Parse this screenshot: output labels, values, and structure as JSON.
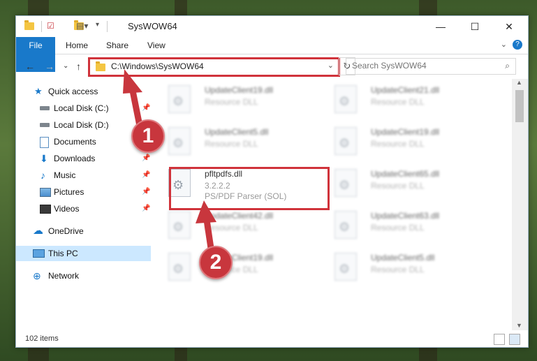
{
  "window": {
    "title": "SysWOW64",
    "controls": {
      "minimize": "—",
      "maximize": "☐",
      "close": "✕"
    }
  },
  "ribbon": {
    "tabs": [
      "File",
      "Home",
      "Share",
      "View"
    ],
    "help": "?"
  },
  "address": {
    "path": "C:\\Windows\\SysWOW64",
    "search_placeholder": "Search SysWOW64"
  },
  "sidebar": {
    "items": [
      {
        "label": "Quick access",
        "icon": "star-icon",
        "pinned": false
      },
      {
        "label": "Local Disk (C:)",
        "icon": "drive-icon",
        "pinned": true
      },
      {
        "label": "Local Disk (D:)",
        "icon": "drive-icon",
        "pinned": false
      },
      {
        "label": "Documents",
        "icon": "documents-icon",
        "pinned": true
      },
      {
        "label": "Downloads",
        "icon": "downloads-icon",
        "pinned": true
      },
      {
        "label": "Music",
        "icon": "music-icon",
        "pinned": true
      },
      {
        "label": "Pictures",
        "icon": "pictures-icon",
        "pinned": true
      },
      {
        "label": "Videos",
        "icon": "videos-icon",
        "pinned": true
      },
      {
        "label": "OneDrive",
        "icon": "onedrive-icon",
        "pinned": false
      },
      {
        "label": "This PC",
        "icon": "pc-icon",
        "pinned": false,
        "selected": true
      },
      {
        "label": "Network",
        "icon": "network-icon",
        "pinned": false
      }
    ]
  },
  "files": {
    "left": [
      {
        "name": "UpdateClient19.dll",
        "desc": "Resource DLL"
      },
      {
        "name": "UpdateClient5.dll",
        "desc": "Resource DLL"
      },
      {
        "name": "pfltpdfs.dll",
        "version": "3.2.2.2",
        "desc": "PS/PDF Parser (SOL)"
      },
      {
        "name": "UpdateClient42.dll",
        "desc": "Resource DLL"
      },
      {
        "name": "UpdateClient19.dll",
        "desc": "Resource DLL"
      }
    ],
    "right": [
      {
        "name": "UpdateClient21.dll",
        "desc": "Resource DLL"
      },
      {
        "name": "UpdateClient19.dll",
        "desc": "Resource DLL"
      },
      {
        "name": "UpdateClient65.dll",
        "desc": "Resource DLL"
      },
      {
        "name": "UpdateClient63.dll",
        "desc": "Resource DLL"
      },
      {
        "name": "UpdateClient5.dll",
        "desc": "Resource DLL"
      }
    ]
  },
  "status": {
    "item_count": "102 items"
  },
  "callouts": {
    "one": "1",
    "two": "2"
  },
  "colors": {
    "accent": "#1979ca",
    "highlight": "#d0333b",
    "selection": "#cce8ff"
  }
}
